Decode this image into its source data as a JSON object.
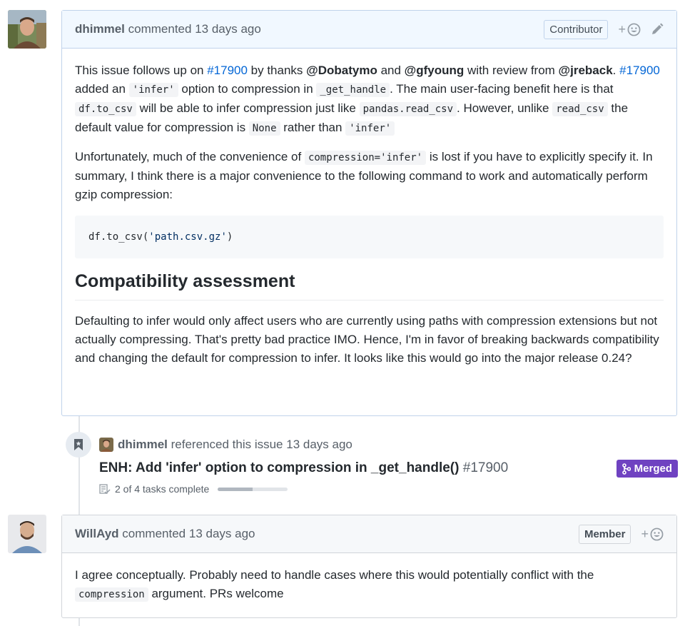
{
  "comment1": {
    "author": "dhimmel",
    "action": "commented",
    "time": "13 days ago",
    "role": "Contributor",
    "p1": {
      "t1": "This issue follows up on ",
      "link1": "#17900",
      "t2": " by thanks ",
      "mention1": "@Dobatymo",
      "t3": " and ",
      "mention2": "@gfyoung",
      "t4": " with review from ",
      "mention3": "@jreback",
      "t5": ". ",
      "link2": "#17900",
      "t6": " added an ",
      "code1": "'infer'",
      "t7": " option to compression in ",
      "code2": "_get_handle",
      "t8": ". The main user-facing benefit here is that ",
      "code3": "df.to_csv",
      "t9": " will be able to infer compression just like ",
      "code4": "pandas.read_csv",
      "t10": ". However, unlike ",
      "code5": "read_csv",
      "t11": " the default value for compression is ",
      "code6": "None",
      "t12": " rather than ",
      "code7": "'infer'"
    },
    "p2": {
      "t1": "Unfortunately, much of the convenience of ",
      "code1": "compression='infer'",
      "t2": " is lost if you have to explicitly specify it. In summary, I think there is a major convenience to the following command to work and automatically perform gzip compression:"
    },
    "code_block": {
      "prefix": "df.to_csv(",
      "string": "'path.csv.gz'",
      "suffix": ")"
    },
    "heading": "Compatibility assessment",
    "p3": "Defaulting to infer would only affect users who are currently using paths with compression extensions but not actually compressing. That's pretty bad practice IMO. Hence, I'm in favor of breaking backwards compatibility and changing the default for compression to infer. It looks like this would go into the major release 0.24?"
  },
  "reference": {
    "author": "dhimmel",
    "action": "referenced this issue",
    "time": "13 days ago",
    "title": "ENH: Add 'infer' option to compression in _get_handle()",
    "number": "#17900",
    "status": "Merged",
    "tasks": "2 of 4 tasks complete",
    "task_progress": 0.5
  },
  "comment2": {
    "author": "WillAyd",
    "action": "commented",
    "time": "13 days ago",
    "role": "Member",
    "t1": "I agree conceptually. Probably need to handle cases where this would potentially conflict with the ",
    "code1": "compression",
    "t2": " argument. PRs welcome"
  },
  "icons": {
    "react": "smiley-icon",
    "edit": "pencil-icon",
    "reference": "bookmark-icon",
    "merged": "git-merge-icon",
    "tasks": "checklist-icon"
  },
  "colors": {
    "merged": "#6f42c1",
    "link": "#0366d6"
  }
}
